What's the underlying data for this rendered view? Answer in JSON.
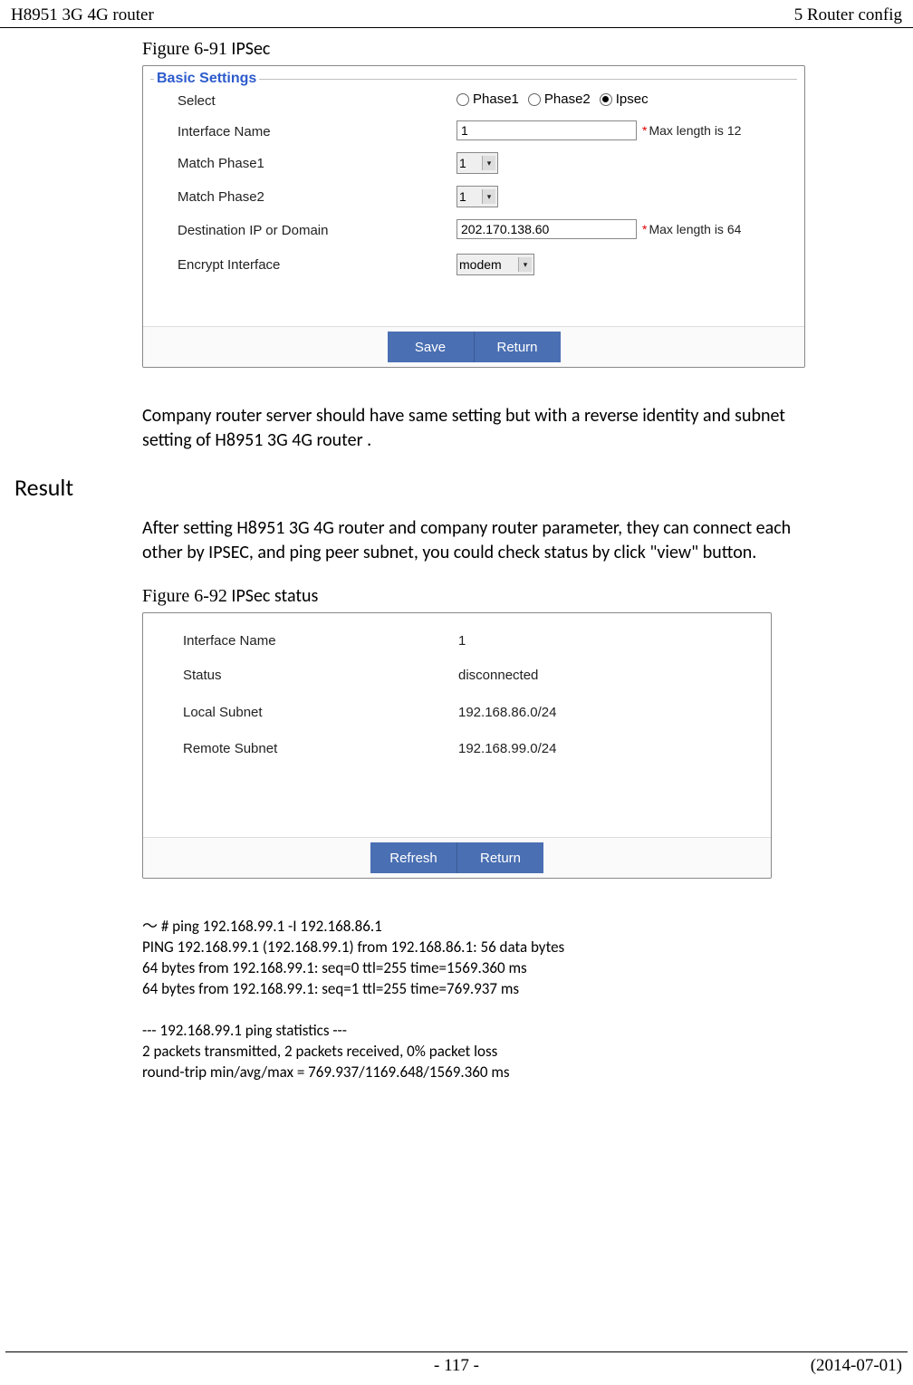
{
  "header": {
    "left": "H8951 3G 4G router",
    "right": "5  Router config"
  },
  "footer": {
    "page": "- 117 -",
    "date": "(2014-07-01)"
  },
  "fig1": {
    "caption_no": "Figure 6-91",
    "caption_name": "  IPSec",
    "section": "Basic Settings",
    "labels": {
      "select": "Select",
      "ifname": "Interface Name",
      "mp1": "Match Phase1",
      "mp2": "Match Phase2",
      "dest": "Destination IP or Domain",
      "enc": "Encrypt Interface"
    },
    "radio": {
      "p1": "Phase1",
      "p2": "Phase2",
      "ipsec": "Ipsec",
      "selected": "ipsec"
    },
    "values": {
      "ifname": "1",
      "mp1": "1",
      "mp2": "1",
      "dest": "202.170.138.60",
      "enc": "modem"
    },
    "hints": {
      "max12": "Max length is 12",
      "max64": "Max length is 64"
    },
    "buttons": {
      "save": "Save",
      "ret": "Return"
    }
  },
  "para1": "Company router server should have same setting but with a reverse identity and subnet setting of H8951 3G 4G router .",
  "h_result": "Result",
  "para2": "After setting H8951 3G 4G router    and company router parameter, they can connect each other by IPSEC, and ping peer subnet, you could check status by click \"view\" button.",
  "fig2": {
    "caption_no": "Figure 6-92",
    "caption_name": "  IPSec status",
    "labels": {
      "ifname": "Interface Name",
      "status": "Status",
      "local": "Local Subnet",
      "remote": "Remote Subnet"
    },
    "values": {
      "ifname": "1",
      "status": "disconnected",
      "local": "192.168.86.0/24",
      "remote": "192.168.99.0/24"
    },
    "buttons": {
      "refresh": "Refresh",
      "ret": "Return"
    }
  },
  "pingtext": "～ # ping 192.168.99.1 -I 192.168.86.1\nPING 192.168.99.1 (192.168.99.1) from 192.168.86.1: 56 data bytes\n64 bytes from 192.168.99.1: seq=0 ttl=255 time=1569.360 ms\n64 bytes from 192.168.99.1: seq=1 ttl=255 time=769.937 ms\n\n--- 192.168.99.1 ping statistics ---\n2 packets transmitted, 2 packets received, 0% packet loss\nround-trip min/avg/max = 769.937/1169.648/1569.360 ms"
}
